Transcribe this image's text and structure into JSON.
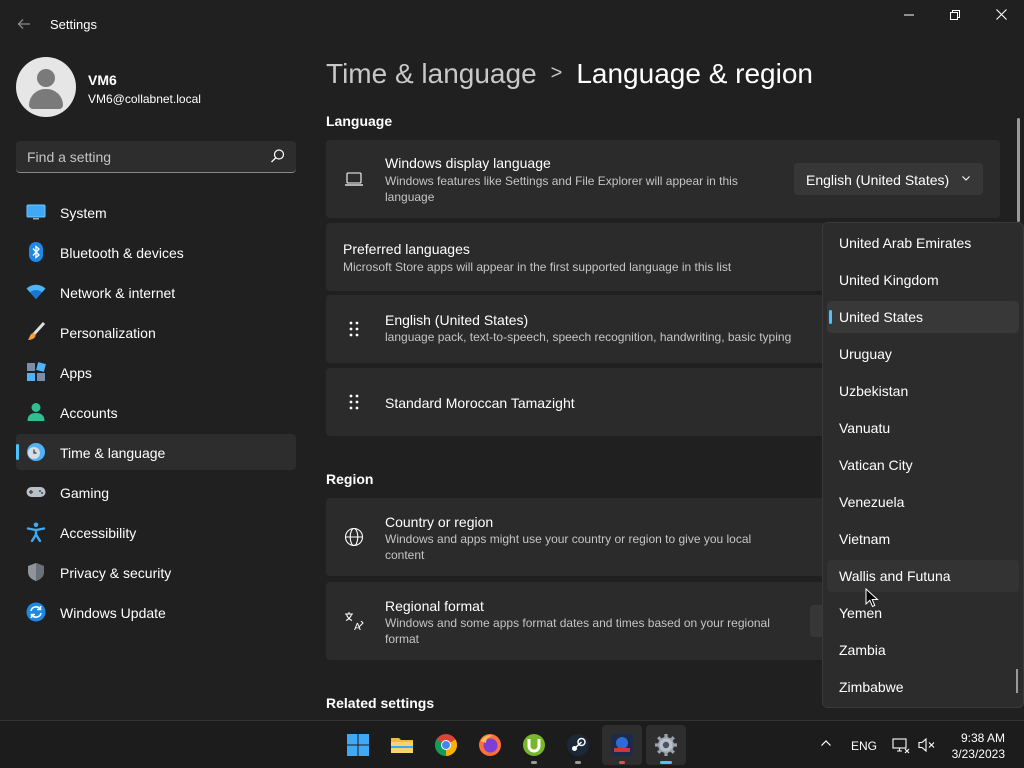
{
  "window": {
    "title": "Settings",
    "back_icon": "back-arrow-icon",
    "minimize_icon": "minimize-icon",
    "maximize_icon": "restore-icon",
    "close_icon": "close-icon"
  },
  "profile": {
    "name": "VM6",
    "email": "VM6@collabnet.local"
  },
  "search": {
    "placeholder": "Find a setting",
    "icon": "search-icon"
  },
  "nav": [
    {
      "label": "System",
      "icon": "system-icon"
    },
    {
      "label": "Bluetooth & devices",
      "icon": "bluetooth-icon"
    },
    {
      "label": "Network & internet",
      "icon": "wifi-icon"
    },
    {
      "label": "Personalization",
      "icon": "brush-icon"
    },
    {
      "label": "Apps",
      "icon": "apps-icon"
    },
    {
      "label": "Accounts",
      "icon": "accounts-icon"
    },
    {
      "label": "Time & language",
      "icon": "time-language-icon",
      "active": true
    },
    {
      "label": "Gaming",
      "icon": "gamepad-icon"
    },
    {
      "label": "Accessibility",
      "icon": "accessibility-icon"
    },
    {
      "label": "Privacy & security",
      "icon": "shield-icon"
    },
    {
      "label": "Windows Update",
      "icon": "update-icon"
    }
  ],
  "breadcrumb": {
    "parent": "Time & language",
    "separator": ">",
    "current": "Language & region"
  },
  "language": {
    "section_title": "Language",
    "display_language": {
      "title": "Windows display language",
      "description_line1": "Windows features like Settings and File Explorer will appear in this",
      "description_line2": "language",
      "value": "English (United States)"
    },
    "preferred": {
      "title": "Preferred languages",
      "description": "Microsoft Store apps will appear in the first supported language in this list"
    },
    "items": [
      {
        "title": "English (United States)",
        "description": "language pack, text-to-speech, speech recognition, handwriting, basic typing"
      },
      {
        "title": "Standard Moroccan Tamazight",
        "description": ""
      }
    ]
  },
  "region": {
    "section_title": "Region",
    "country": {
      "title": "Country or region",
      "description_line1": "Windows and apps might use your country or region to give you local",
      "description_line2": "content"
    },
    "format": {
      "title": "Regional format",
      "description_line1": "Windows and some apps format dates and times based on your regional",
      "description_line2": "format"
    }
  },
  "related": {
    "section_title": "Related settings"
  },
  "country_list": {
    "items": [
      "United Arab Emirates",
      "United Kingdom",
      "United States",
      "Uruguay",
      "Uzbekistan",
      "Vanuatu",
      "Vatican City",
      "Venezuela",
      "Vietnam",
      "Wallis and Futuna",
      "Yemen",
      "Zambia",
      "Zimbabwe"
    ],
    "selected": "United States",
    "hovered": "Wallis and Futuna"
  },
  "taskbar": {
    "apps": [
      {
        "name": "windows-start-icon"
      },
      {
        "name": "file-explorer-icon"
      },
      {
        "name": "chrome-icon"
      },
      {
        "name": "firefox-icon"
      },
      {
        "name": "utorrent-icon"
      },
      {
        "name": "steam-icon"
      },
      {
        "name": "game-app-icon"
      },
      {
        "name": "settings-app-icon"
      }
    ],
    "tray_language": "ENG",
    "time": "9:38 AM",
    "date": "3/23/2023"
  },
  "colors": {
    "accent": "#4cc2ff",
    "background": "#202020",
    "card": "#2b2b2b"
  }
}
